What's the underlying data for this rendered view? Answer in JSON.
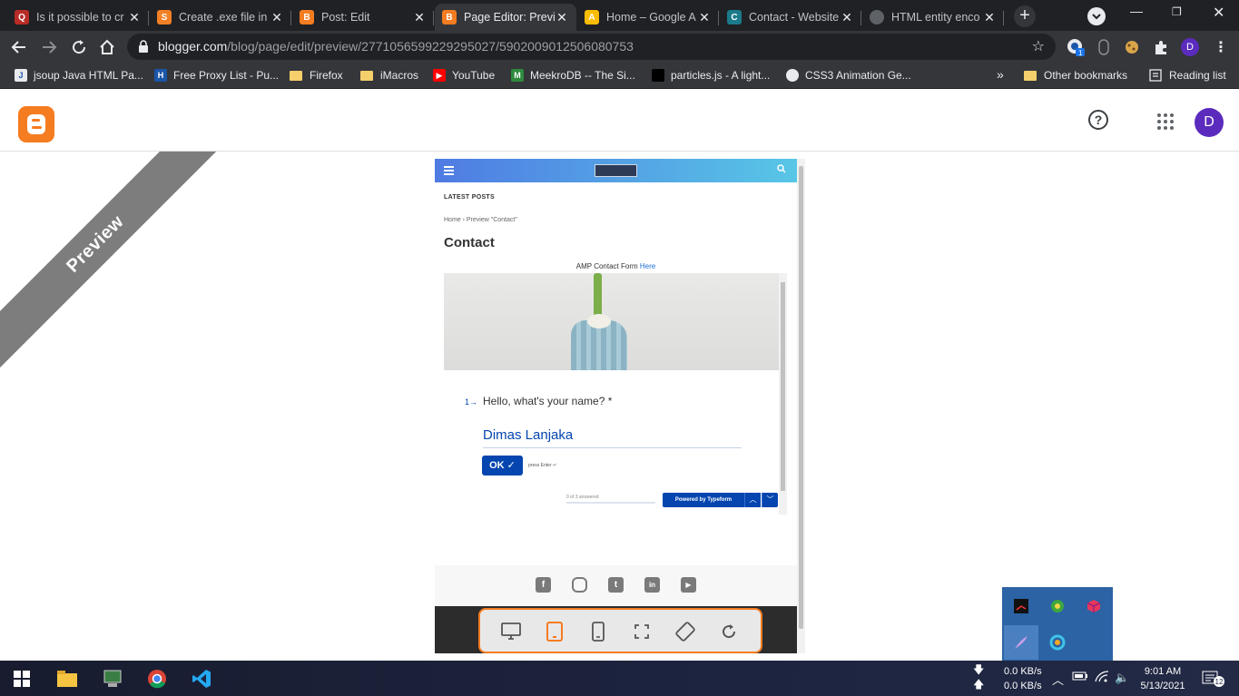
{
  "tabs": [
    {
      "title": "Is it possible to cr",
      "icon": "quora-icon",
      "color": "#b92b27",
      "glyph": "Q",
      "active": false
    },
    {
      "title": "Create .exe file in",
      "icon": "stackoverflow-icon",
      "color": "#f48024",
      "glyph": "S",
      "active": false
    },
    {
      "title": "Post: Edit",
      "icon": "blogger-icon",
      "color": "#f57c21",
      "glyph": "B",
      "active": false
    },
    {
      "title": "Page Editor: Previ",
      "icon": "blogger-icon",
      "color": "#f57c21",
      "glyph": "B",
      "active": true
    },
    {
      "title": "Home – Google A",
      "icon": "google-ads-icon",
      "color": "#fbbc04",
      "glyph": "A",
      "active": false
    },
    {
      "title": "Contact - Website",
      "icon": "website-icon",
      "color": "#1b7b8a",
      "glyph": "C",
      "active": false
    },
    {
      "title": "HTML entity enco",
      "icon": "globe-icon",
      "color": "#5f6368",
      "glyph": "",
      "active": false
    }
  ],
  "address": {
    "host": "blogger.com",
    "path": "/blog/page/edit/preview/2771056599229295027/5902009012506080753"
  },
  "extensions": {
    "badge": "1",
    "profile_letter": "D"
  },
  "bookmarks": [
    {
      "label": "jsoup Java HTML Pa...",
      "icon": "jsoup-icon",
      "color": "#e8eaed",
      "glyph": "J"
    },
    {
      "label": "Free Proxy List - Pu...",
      "icon": "proxy-icon",
      "color": "#1a56a8",
      "glyph": "H"
    },
    {
      "label": "Firefox",
      "icon": "folder-icon",
      "color": "",
      "glyph": ""
    },
    {
      "label": "iMacros",
      "icon": "folder-icon",
      "color": "",
      "glyph": ""
    },
    {
      "label": "YouTube",
      "icon": "youtube-icon",
      "color": "#ff0000",
      "glyph": "▶"
    },
    {
      "label": "MeekroDB -- The Si...",
      "icon": "meekrodb-icon",
      "color": "#2e8b3e",
      "glyph": "M"
    },
    {
      "label": "particles.js - A light...",
      "icon": "particles-icon",
      "color": "#000000",
      "glyph": ""
    },
    {
      "label": "CSS3 Animation Ge...",
      "icon": "css3-icon",
      "color": "#ffffff",
      "glyph": ""
    }
  ],
  "bookmarks_more": "»",
  "other_bookmarks": "Other bookmarks",
  "reading_list": "Reading list",
  "blogger": {
    "help": "?",
    "profile_letter": "D",
    "ribbon": "Preview"
  },
  "preview_page": {
    "latest_posts": "LATEST POSTS",
    "breadcrumb": "Home › Preview \"Contact\"",
    "title": "Contact",
    "amp_text": "AMP Contact Form ",
    "amp_link": "Here",
    "question_number": "1→",
    "question": "Hello, what's your name? *",
    "answer": "Dimas Lanjaka",
    "ok_label": "OK ✓",
    "press_enter": "press Enter ↵",
    "progress_text": "0 of 3 answered",
    "powered_by": "Powered by Typeform",
    "up_arrow": "︿",
    "down_arrow": "﹀",
    "social": [
      {
        "name": "facebook-icon",
        "glyph": "f"
      },
      {
        "name": "instagram-icon",
        "glyph": ""
      },
      {
        "name": "twitter-icon",
        "glyph": "t"
      },
      {
        "name": "linkedin-icon",
        "glyph": "in"
      },
      {
        "name": "youtube-icon",
        "glyph": "▶"
      }
    ]
  },
  "device_buttons": [
    "desktop-icon",
    "tablet-icon",
    "mobile-icon",
    "fullscreen-icon",
    "rotate-icon",
    "refresh-icon"
  ],
  "taskbar": {
    "speed_down": "0.0 KB/s",
    "speed_up": "0.0 KB/s",
    "time": "9:01 AM",
    "date": "5/13/2021",
    "notifications": "12"
  }
}
